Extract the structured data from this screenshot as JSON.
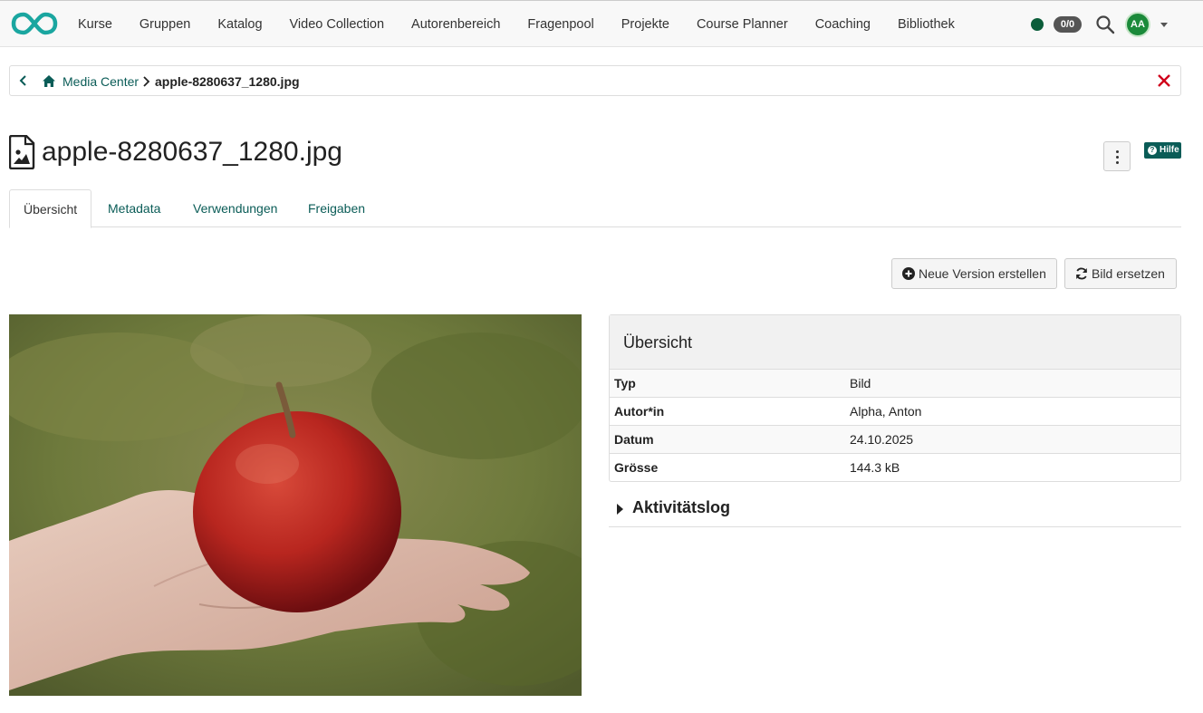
{
  "nav": {
    "items": [
      "Kurse",
      "Gruppen",
      "Katalog",
      "Video Collection",
      "Autorenbereich",
      "Fragenpool",
      "Projekte",
      "Course Planner",
      "Coaching",
      "Bibliothek"
    ],
    "badge_count": "0/0",
    "avatar_initials": "AA"
  },
  "breadcrumb": {
    "media_center": "Media Center",
    "current": "apple-8280637_1280.jpg"
  },
  "page": {
    "title": "apple-8280637_1280.jpg",
    "help": "Hilfe"
  },
  "tabs": [
    "Übersicht",
    "Metadata",
    "Verwendungen",
    "Freigaben"
  ],
  "actions": {
    "new_version": "Neue Version erstellen",
    "replace_image": "Bild ersetzen"
  },
  "overview": {
    "title": "Übersicht",
    "rows": [
      {
        "key": "Typ",
        "value": "Bild"
      },
      {
        "key": "Autor*in",
        "value": "Alpha, Anton"
      },
      {
        "key": "Datum",
        "value": "24.10.2025"
      },
      {
        "key": "Grösse",
        "value": "144.3 kB"
      }
    ]
  },
  "activity_log": {
    "label": "Aktivitätslog"
  },
  "colors": {
    "brand": "#0a5c57",
    "close": "#d0021b",
    "status_online": "#0b5d3a",
    "avatar_bg": "#1b8a3a"
  }
}
